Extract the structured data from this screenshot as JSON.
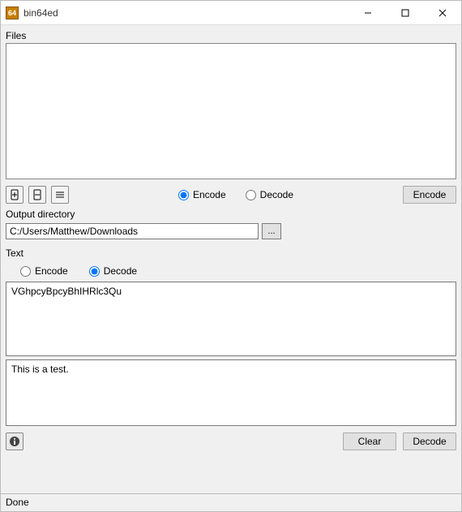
{
  "window": {
    "title": "bin64ed",
    "icon_text": "64"
  },
  "files": {
    "label": "Files",
    "mode_encode": "Encode",
    "mode_decode": "Decode",
    "mode_selected": "encode",
    "action_button": "Encode",
    "output_dir_label": "Output directory",
    "output_dir_value": "C:/Users/Matthew/Downloads",
    "browse_label": "...",
    "icons": {
      "add": "add-file-icon",
      "remove": "remove-file-icon",
      "list": "list-icon"
    }
  },
  "text": {
    "label": "Text",
    "mode_encode": "Encode",
    "mode_decode": "Decode",
    "mode_selected": "decode",
    "input_value": "VGhpcyBpcyBhIHRlc3Qu",
    "output_value": "This is a test.",
    "clear_button": "Clear",
    "action_button": "Decode"
  },
  "status": {
    "text": "Done"
  }
}
